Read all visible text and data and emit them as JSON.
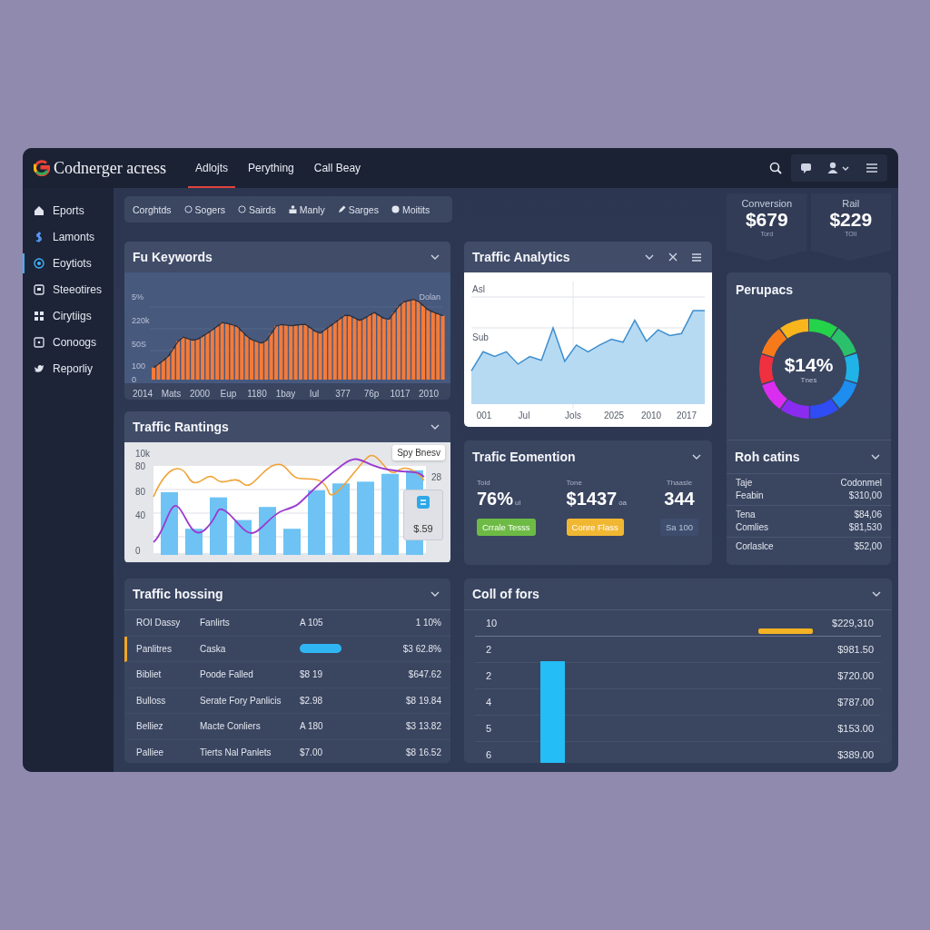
{
  "app": {
    "title": "Codnerger acress"
  },
  "nav_tabs": [
    {
      "label": "Adlojts",
      "selected": true
    },
    {
      "label": "Perything",
      "selected": false
    },
    {
      "label": "Call Beay",
      "selected": false
    }
  ],
  "sidebar": {
    "items": [
      {
        "label": "Eports",
        "selected": false
      },
      {
        "label": "Lamonts",
        "selected": false
      },
      {
        "label": "Eoytiots",
        "selected": true
      },
      {
        "label": "Steeotires",
        "selected": false
      },
      {
        "label": "Cirytiigs",
        "selected": false
      },
      {
        "label": "Conoogs",
        "selected": false
      },
      {
        "label": "Reporliy",
        "selected": false
      }
    ]
  },
  "filters": [
    "Corghtds",
    "Sogers",
    "Sairds",
    "Manly",
    "Sarges",
    "Moitits"
  ],
  "kpis": [
    {
      "label": "Conversion",
      "value": "$679",
      "sub": "Tord"
    },
    {
      "label": "Rail",
      "value": "$229",
      "sub": "TOIl"
    }
  ],
  "keywords_panel": {
    "title": "Fu Keywords",
    "legend": "Dolan",
    "y_labels": [
      "5%",
      "220k",
      "50S",
      "100",
      "0"
    ],
    "x_labels": [
      "2014",
      "Mats",
      "2000",
      "Eup",
      "1180",
      "1bay",
      "Iul",
      "377",
      "76p",
      "1017",
      "2010"
    ]
  },
  "analytics_panel": {
    "title": "Traffic Analytics",
    "y_labels": [
      "Asl",
      "Sub"
    ],
    "x_labels": [
      "001",
      "Jul",
      "Jols",
      "2025",
      "2010",
      "2017"
    ]
  },
  "donut_panel": {
    "title": "Perupacs",
    "value": "$14%",
    "sub": "Tnes"
  },
  "rantings_panel": {
    "title": "Traffic Rantings",
    "y_labels": [
      "10k",
      "80",
      "80",
      "40",
      "0"
    ],
    "right_label": "28",
    "tooltip": "Spy Bnesv",
    "card_value": "$.59"
  },
  "eomention_panel": {
    "title": "Trafic Eomention",
    "stats": [
      {
        "label": "Toid",
        "value": "76%",
        "unit": "ul",
        "button": "Crrale Tesss",
        "color": "#6dbb45"
      },
      {
        "label": "Tone",
        "value": "$1437",
        "unit": "oa",
        "button": "Conre Flass",
        "color": "#f2b732"
      },
      {
        "label": "Thaasle",
        "value": "344",
        "button": "Sa 100",
        "color": "#3e4d6d"
      }
    ]
  },
  "roh_panel": {
    "title": "Roh catins",
    "groups": [
      [
        {
          "label": "Taje",
          "value": "Codonmel"
        },
        {
          "label": "Feabin",
          "value": "$310,00"
        }
      ],
      [
        {
          "label": "Tena",
          "value": "$84,06"
        },
        {
          "label": "Comlies",
          "value": "$81,530"
        }
      ],
      [
        {
          "label": "Corlaslce",
          "value": "$52,00"
        }
      ]
    ]
  },
  "hossing_panel": {
    "title": "Traffic hossing",
    "rows": [
      {
        "kind": "text",
        "name": "ROI Dassy",
        "item": "Fanlirts",
        "qty": "A 105",
        "amount": "1 10%",
        "selected": false
      },
      {
        "kind": "bar",
        "name": "Panlitres",
        "item": "Caska",
        "amount": "$3 62.8%",
        "selected": true
      },
      {
        "kind": "text",
        "name": "Bibliet",
        "item": "Poode Falled",
        "qty": "$8 19",
        "amount": "$647.62",
        "selected": false
      },
      {
        "kind": "text",
        "name": "Bulloss",
        "item": "Serate Fory Panlicis",
        "qty": "$2.98",
        "amount": "$8 19.84",
        "selected": false
      },
      {
        "kind": "text",
        "name": "Belliez",
        "item": "Macte Conliers",
        "qty": "A 180",
        "amount": "$3 13.82",
        "selected": false
      },
      {
        "kind": "text",
        "name": "Palliee",
        "item": "Tierts Nal Panlets",
        "qty": "$7.00",
        "amount": "$8 16.52",
        "selected": false
      }
    ]
  },
  "cols_panel": {
    "title": "Coll of fors",
    "rows": [
      {
        "label": "10",
        "value": "$229,310"
      },
      {
        "label": "2",
        "value": "$981.50"
      },
      {
        "label": "2",
        "value": "$720.00"
      },
      {
        "label": "4",
        "value": "$787.00"
      },
      {
        "label": "5",
        "value": "$153.00"
      },
      {
        "label": "6",
        "value": "$389.00"
      }
    ]
  }
}
